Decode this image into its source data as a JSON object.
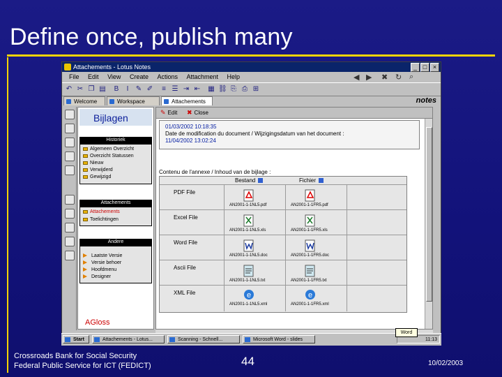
{
  "slide": {
    "title": "Define once, publish many",
    "footer_line1": "Crossroads Bank for Social Security",
    "footer_line2": "Federal Public Service for ICT (FEDICT)",
    "page_number": "44",
    "date": "10/02/2003",
    "accent_color": "#f5d400",
    "background_color": "#14147a"
  },
  "window": {
    "title": "Attachements - Lotus Notes",
    "controls": [
      "_",
      "□",
      "×"
    ],
    "menu": [
      "File",
      "Edit",
      "View",
      "Create",
      "Actions",
      "Attachment",
      "Help"
    ],
    "tabs": [
      {
        "label": "Welcome"
      },
      {
        "label": "Workspace"
      },
      {
        "label": "Attachements",
        "close": "×"
      }
    ],
    "brand": "notes"
  },
  "navigator": {
    "header": "Bijlagen",
    "sections": [
      {
        "title": "Historiek",
        "items": [
          "Algemeen Overzicht",
          "Overzicht Statussen",
          "Nieuw",
          "Verwijderd",
          "Gewijzigd"
        ]
      },
      {
        "title": "Attachements",
        "items": [
          "Attachements",
          "Toelichtingen"
        ]
      },
      {
        "title": "Andere",
        "items": [
          "Laatste Versie",
          "Versie behoer",
          "Hoofdmenu",
          "Designer"
        ]
      }
    ],
    "footer": "AGloss"
  },
  "document": {
    "actions": [
      {
        "label": "Edit"
      },
      {
        "label": "Close"
      }
    ],
    "modified_date": "01/03/2002 10:18:35",
    "modification_label": "Date de modification du document / Wijzigingsdatum van het document :",
    "modification_date": "11/04/2002 13:02:24",
    "contents_label": "Contenu de l'annexe / Inhoud van de bijlage :",
    "table_headers": [
      "Bestand",
      "Fichier"
    ],
    "rows": [
      {
        "label": "PDF File",
        "file_nl": "AN2001-1-1NL5.pdf",
        "file_fr": "AN2001-1-1FR5.pdf"
      },
      {
        "label": "Excel File",
        "file_nl": "AN2001-1-1NL5.xls",
        "file_fr": "AN2001-1-1FR5.xls"
      },
      {
        "label": "Word File",
        "file_nl": "AN2001-1-1NL5.doc",
        "file_fr": "AN2001-1-1FR5.doc"
      },
      {
        "label": "Ascii File",
        "file_nl": "AN2001-1-1NL5.txt",
        "file_fr": "AN2001-1-1FR5.txt"
      },
      {
        "label": "XML File",
        "file_nl": "AN2001-1-1NL5.xml",
        "file_fr": "AN2001-1-1FR5.xml"
      }
    ]
  },
  "taskbar": {
    "start": "Start",
    "buttons": [
      "Attachements - Lotus...",
      "Scanning - Schnell...",
      "Microsoft Word - slides"
    ],
    "clock": "11:13",
    "tooltip": "Word"
  }
}
